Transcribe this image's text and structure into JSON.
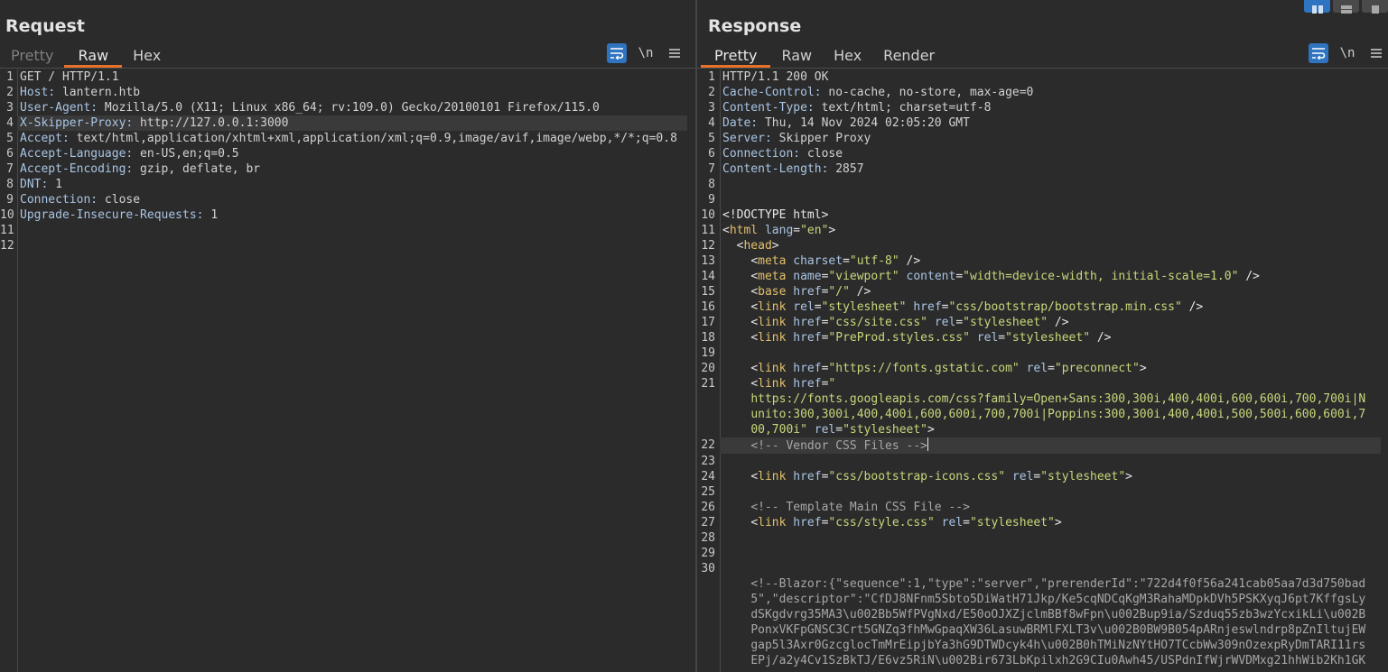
{
  "request": {
    "title": "Request",
    "tabs": [
      {
        "label": "Pretty",
        "state": "dim"
      },
      {
        "label": "Raw",
        "state": "active"
      },
      {
        "label": "Hex",
        "state": "normal"
      }
    ],
    "toolbar": {
      "newline_label": "\\n"
    },
    "lines": [
      {
        "n": "1",
        "name": "GET / HTTP/1.1",
        "sep": "",
        "value": ""
      },
      {
        "n": "2",
        "name": "Host",
        "sep": ":",
        "value": " lantern.htb"
      },
      {
        "n": "3",
        "name": "User-Agent",
        "sep": ":",
        "value": " Mozilla/5.0 (X11; Linux x86_64; rv:109.0) Gecko/20100101 Firefox/115.0"
      },
      {
        "n": "4",
        "name": "X-Skipper-Proxy",
        "sep": ":",
        "value": " http://127.0.0.1:3000",
        "highlight": true
      },
      {
        "n": "5",
        "name": "Accept",
        "sep": ":",
        "value": " text/html,application/xhtml+xml,application/xml;q=0.9,image/avif,image/webp,*/*;q=0.8"
      },
      {
        "n": "6",
        "name": "Accept-Language",
        "sep": ":",
        "value": " en-US,en;q=0.5"
      },
      {
        "n": "7",
        "name": "Accept-Encoding",
        "sep": ":",
        "value": " gzip, deflate, br"
      },
      {
        "n": "8",
        "name": "DNT",
        "sep": ":",
        "value": " 1"
      },
      {
        "n": "9",
        "name": "Connection",
        "sep": ":",
        "value": " close"
      },
      {
        "n": "10",
        "name": "Upgrade-Insecure-Requests",
        "sep": ":",
        "value": " 1"
      },
      {
        "n": "11",
        "name": "",
        "sep": "",
        "value": ""
      },
      {
        "n": "12",
        "name": "",
        "sep": "",
        "value": ""
      }
    ]
  },
  "response": {
    "title": "Response",
    "tabs": [
      {
        "label": "Pretty",
        "state": "active"
      },
      {
        "label": "Raw",
        "state": "normal"
      },
      {
        "label": "Hex",
        "state": "normal"
      },
      {
        "label": "Render",
        "state": "normal"
      }
    ],
    "toolbar": {
      "newline_label": "\\n"
    },
    "lines": [
      {
        "n": "1",
        "segs": [
          [
            "plain",
            "HTTP/1.1 200 OK"
          ]
        ]
      },
      {
        "n": "2",
        "segs": [
          [
            "hname",
            "Cache-Control:"
          ],
          [
            "hval",
            " no-cache, no-store, max-age=0"
          ]
        ]
      },
      {
        "n": "3",
        "segs": [
          [
            "hname",
            "Content-Type:"
          ],
          [
            "hval",
            " text/html; charset=utf-8"
          ]
        ]
      },
      {
        "n": "4",
        "segs": [
          [
            "hname",
            "Date:"
          ],
          [
            "hval",
            " Thu, 14 Nov 2024 02:05:20 GMT"
          ]
        ]
      },
      {
        "n": "5",
        "segs": [
          [
            "hname",
            "Server:"
          ],
          [
            "hval",
            " Skipper Proxy"
          ]
        ]
      },
      {
        "n": "6",
        "segs": [
          [
            "hname",
            "Connection:"
          ],
          [
            "hval",
            " close"
          ]
        ]
      },
      {
        "n": "7",
        "segs": [
          [
            "hname",
            "Content-Length:"
          ],
          [
            "hval",
            " 2857"
          ]
        ]
      },
      {
        "n": "8",
        "segs": []
      },
      {
        "n": "9",
        "segs": []
      },
      {
        "n": "10",
        "segs": [
          [
            "tag",
            "<!DOCTYPE html>"
          ]
        ]
      },
      {
        "n": "11",
        "segs": [
          [
            "tag",
            "<"
          ],
          [
            "tagname",
            "html"
          ],
          [
            "tag",
            " "
          ],
          [
            "attr",
            "lang"
          ],
          [
            "tag",
            "="
          ],
          [
            "str",
            "\"en\""
          ],
          [
            "tag",
            ">"
          ]
        ]
      },
      {
        "n": "12",
        "segs": [
          [
            "tag",
            "  <"
          ],
          [
            "tagname",
            "head"
          ],
          [
            "tag",
            ">"
          ]
        ]
      },
      {
        "n": "13",
        "segs": [
          [
            "tag",
            "    <"
          ],
          [
            "tagname",
            "meta"
          ],
          [
            "tag",
            " "
          ],
          [
            "attr",
            "charset"
          ],
          [
            "tag",
            "="
          ],
          [
            "str",
            "\"utf-8\""
          ],
          [
            "tag",
            " />"
          ]
        ]
      },
      {
        "n": "14",
        "segs": [
          [
            "tag",
            "    <"
          ],
          [
            "tagname",
            "meta"
          ],
          [
            "tag",
            " "
          ],
          [
            "attr",
            "name"
          ],
          [
            "tag",
            "="
          ],
          [
            "str",
            "\"viewport\""
          ],
          [
            "tag",
            " "
          ],
          [
            "attr",
            "content"
          ],
          [
            "tag",
            "="
          ],
          [
            "str",
            "\"width=device-width, initial-scale=1.0\""
          ],
          [
            "tag",
            " />"
          ]
        ]
      },
      {
        "n": "15",
        "segs": [
          [
            "tag",
            "    <"
          ],
          [
            "tagname",
            "base"
          ],
          [
            "tag",
            " "
          ],
          [
            "attr",
            "href"
          ],
          [
            "tag",
            "="
          ],
          [
            "str",
            "\"/\""
          ],
          [
            "tag",
            " />"
          ]
        ]
      },
      {
        "n": "16",
        "segs": [
          [
            "tag",
            "    <"
          ],
          [
            "tagname",
            "link"
          ],
          [
            "tag",
            " "
          ],
          [
            "attr",
            "rel"
          ],
          [
            "tag",
            "="
          ],
          [
            "str",
            "\"stylesheet\""
          ],
          [
            "tag",
            " "
          ],
          [
            "attr",
            "href"
          ],
          [
            "tag",
            "="
          ],
          [
            "str",
            "\"css/bootstrap/bootstrap.min.css\""
          ],
          [
            "tag",
            " />"
          ]
        ]
      },
      {
        "n": "17",
        "segs": [
          [
            "tag",
            "    <"
          ],
          [
            "tagname",
            "link"
          ],
          [
            "tag",
            " "
          ],
          [
            "attr",
            "href"
          ],
          [
            "tag",
            "="
          ],
          [
            "str",
            "\"css/site.css\""
          ],
          [
            "tag",
            " "
          ],
          [
            "attr",
            "rel"
          ],
          [
            "tag",
            "="
          ],
          [
            "str",
            "\"stylesheet\""
          ],
          [
            "tag",
            " />"
          ]
        ]
      },
      {
        "n": "18",
        "segs": [
          [
            "tag",
            "    <"
          ],
          [
            "tagname",
            "link"
          ],
          [
            "tag",
            " "
          ],
          [
            "attr",
            "href"
          ],
          [
            "tag",
            "="
          ],
          [
            "str",
            "\"PreProd.styles.css\""
          ],
          [
            "tag",
            " "
          ],
          [
            "attr",
            "rel"
          ],
          [
            "tag",
            "="
          ],
          [
            "str",
            "\"stylesheet\""
          ],
          [
            "tag",
            " />"
          ]
        ]
      },
      {
        "n": "19",
        "segs": []
      },
      {
        "n": "20",
        "segs": [
          [
            "tag",
            "    <"
          ],
          [
            "tagname",
            "link"
          ],
          [
            "tag",
            " "
          ],
          [
            "attr",
            "href"
          ],
          [
            "tag",
            "="
          ],
          [
            "str",
            "\"https://fonts.gstatic.com\""
          ],
          [
            "tag",
            " "
          ],
          [
            "attr",
            "rel"
          ],
          [
            "tag",
            "="
          ],
          [
            "str",
            "\"preconnect\""
          ],
          [
            "tag",
            ">"
          ]
        ]
      },
      {
        "n": "21",
        "segs": [
          [
            "tag",
            "    <"
          ],
          [
            "tagname",
            "link"
          ],
          [
            "tag",
            " "
          ],
          [
            "attr",
            "href"
          ],
          [
            "tag",
            "="
          ],
          [
            "str",
            "\"\n    https://fonts.googleapis.com/css?family=Open+Sans:300,300i,400,400i,600,600i,700,700i|N\n    unito:300,300i,400,400i,600,600i,700,700i|Poppins:300,300i,400,400i,500,500i,600,600i,7\n    00,700i\""
          ],
          [
            "tag",
            " "
          ],
          [
            "attr",
            "rel"
          ],
          [
            "tag",
            "="
          ],
          [
            "str",
            "\"stylesheet\""
          ],
          [
            "tag",
            ">"
          ]
        ]
      },
      {
        "n": "22",
        "segs": [
          [
            "comment",
            "    <!-- Vendor CSS Files -->"
          ]
        ],
        "highlight": true,
        "cursor": true
      },
      {
        "n": "23",
        "segs": []
      },
      {
        "n": "24",
        "segs": [
          [
            "tag",
            "    <"
          ],
          [
            "tagname",
            "link"
          ],
          [
            "tag",
            " "
          ],
          [
            "attr",
            "href"
          ],
          [
            "tag",
            "="
          ],
          [
            "str",
            "\"css/bootstrap-icons.css\""
          ],
          [
            "tag",
            " "
          ],
          [
            "attr",
            "rel"
          ],
          [
            "tag",
            "="
          ],
          [
            "str",
            "\"stylesheet\""
          ],
          [
            "tag",
            ">"
          ]
        ]
      },
      {
        "n": "25",
        "segs": []
      },
      {
        "n": "26",
        "segs": [
          [
            "comment",
            "    <!-- Template Main CSS File -->"
          ]
        ]
      },
      {
        "n": "27",
        "segs": [
          [
            "tag",
            "    <"
          ],
          [
            "tagname",
            "link"
          ],
          [
            "tag",
            " "
          ],
          [
            "attr",
            "href"
          ],
          [
            "tag",
            "="
          ],
          [
            "str",
            "\"css/style.css\""
          ],
          [
            "tag",
            " "
          ],
          [
            "attr",
            "rel"
          ],
          [
            "tag",
            "="
          ],
          [
            "str",
            "\"stylesheet\""
          ],
          [
            "tag",
            ">"
          ]
        ]
      },
      {
        "n": "28",
        "segs": []
      },
      {
        "n": "29",
        "segs": []
      },
      {
        "n": "30",
        "segs": [
          [
            "comment",
            "\n    <!--Blazor:{\"sequence\":1,\"type\":\"server\",\"prerenderId\":\"722d4f0f56a241cab05aa7d3d750bad\n    5\",\"descriptor\":\"CfDJ8NFnm5Sbto5DiWatH71Jkp/Ke5cqNDCqKgM3RahaMDpkDVh5PSKXyqJ6pt7KffgsLy\n    dSKgdvrg35MA3\\u002Bb5WfPVgNxd/E50oOJXZjclmBBf8wFpn\\u002Bup9ia/Szduq55zb3wzYcxikLi\\u002B\n    PonxVKFpGNSC3Crt5GNZq3fhMwGpaqXW36LasuwBRMlFXLT3v\\u002B0BW9B054pARnjeswlndrp8pZnIltujEW\n    gap5l3Axr0GzcglocTmMrEipjbYa3hG9DTWDcyk4h\\u002B0hTMiNzNYtHO7TCcbWw309nOzexpRyDmTARI11rs\n    EPj/a2y4Cv1SzBkTJ/E6vz5RiN\\u002Bir673LbKpilxh2G9CIu0Awh45/USPdnIfWjrWVDMxg21hhWib2Kh1GK"
          ]
        ]
      }
    ]
  }
}
